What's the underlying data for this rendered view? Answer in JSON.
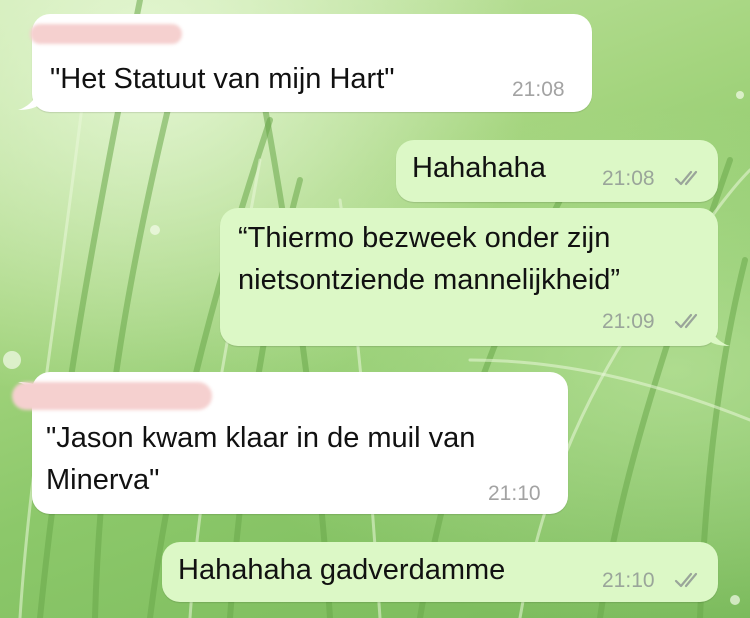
{
  "chat": {
    "messages": [
      {
        "direction": "incoming",
        "sender_redacted": true,
        "text_lines": [
          "\"Het Statuut van mijn Hart\""
        ],
        "time": "21:08"
      },
      {
        "direction": "outgoing",
        "text_lines": [
          "Hahahaha"
        ],
        "time": "21:08",
        "status": "read-double-check"
      },
      {
        "direction": "outgoing",
        "text_lines": [
          "“Thiermo bezweek onder zijn",
          "nietsontziende mannelijkheid”"
        ],
        "time": "21:09",
        "status": "read-double-check"
      },
      {
        "direction": "incoming",
        "sender_redacted": true,
        "text_lines": [
          "\"Jason kwam klaar in de muil van",
          "Minerva\""
        ],
        "time": "21:10"
      },
      {
        "direction": "outgoing",
        "text_lines": [
          "Hahahaha gadverdamme"
        ],
        "time": "21:10",
        "status": "read-double-check"
      }
    ]
  },
  "colors": {
    "incoming_bubble": "#ffffff",
    "outgoing_bubble": "#dcf8c6",
    "redaction": "#f5d0cf",
    "timestamp": "#9aa59a",
    "wallpaper": "#a5d57f"
  },
  "icons": {
    "status_icon": "double-check-icon",
    "redaction_mark": "redacted-name-scribble"
  }
}
